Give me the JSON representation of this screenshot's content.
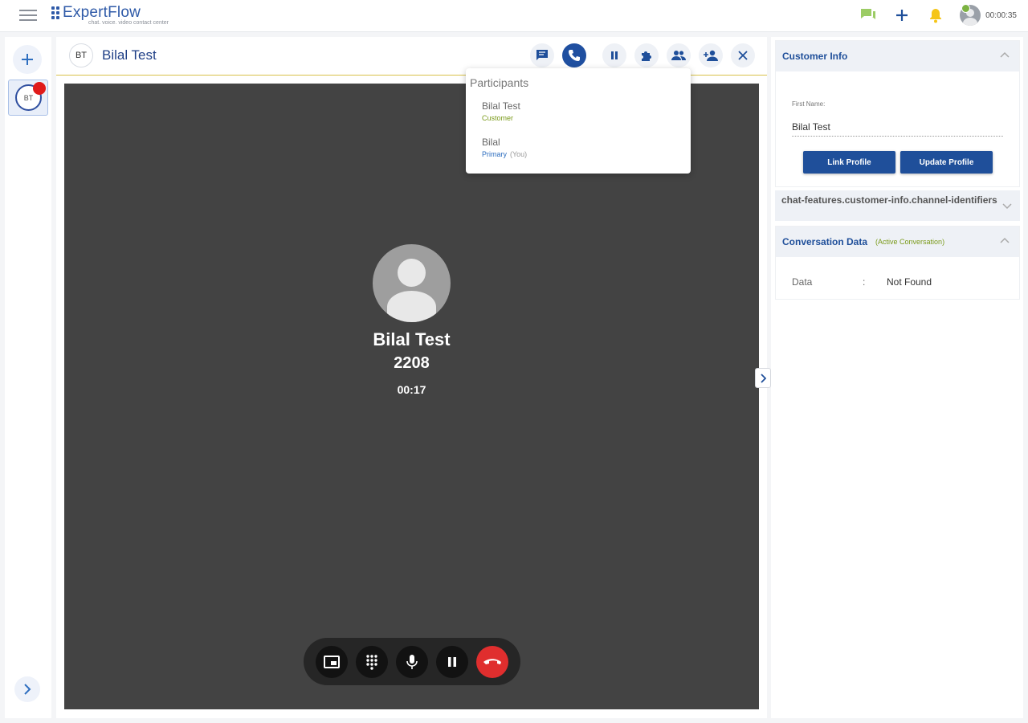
{
  "app": {
    "logo_text": "ExpertFlow",
    "logo_tagline": "chat. voice. video contact center",
    "session_timer": "00:00:35"
  },
  "colors": {
    "brand_blue": "#1f4f9a",
    "accent_green": "#7cb342",
    "notification_yellow": "#f5c518",
    "end_call_red": "#e02e2e",
    "video_bg": "#434343"
  },
  "sidebar": {
    "conversations": [
      {
        "initials": "BT",
        "has_unread": true
      }
    ]
  },
  "chat_header": {
    "initials": "BT",
    "name": "Bilal Test"
  },
  "call": {
    "caller_name": "Bilal Test",
    "caller_number": "2208",
    "duration": "00:17"
  },
  "participants": {
    "title": "Participants",
    "items": [
      {
        "name": "Bilal Test",
        "role": "Customer",
        "you": ""
      },
      {
        "name": "Bilal",
        "role": "Primary",
        "you": "(You)"
      }
    ]
  },
  "customer_info": {
    "title": "Customer Info",
    "first_name_label": "First Name:",
    "first_name_value": "Bilal Test",
    "link_profile_label": "Link Profile",
    "update_profile_label": "Update Profile"
  },
  "channel_identifiers": {
    "title": "chat-features.customer-info.channel-identifiers"
  },
  "conversation_data": {
    "title": "Conversation Data",
    "badge": "(Active Conversation)",
    "key": "Data",
    "separator": ":",
    "value": "Not Found"
  }
}
